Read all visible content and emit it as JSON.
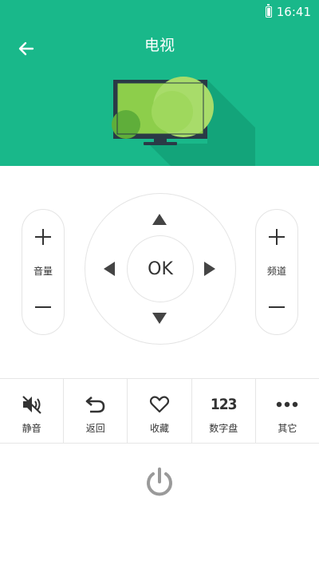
{
  "status": {
    "time": "16:41"
  },
  "header": {
    "title": "电视",
    "bg_color": "#19b88a"
  },
  "volume": {
    "label": "音量",
    "plus_icon": "plus-icon",
    "minus_icon": "minus-icon"
  },
  "channel": {
    "label": "频道",
    "plus_icon": "plus-icon",
    "minus_icon": "minus-icon"
  },
  "dpad": {
    "ok_label": "OK"
  },
  "functions": [
    {
      "label": "静音",
      "icon": "mute-icon"
    },
    {
      "label": "返回",
      "icon": "return-icon"
    },
    {
      "label": "收藏",
      "icon": "heart-icon"
    },
    {
      "label": "数字盘",
      "icon": "number-pad-icon",
      "icon_text": "123"
    },
    {
      "label": "其它",
      "icon": "more-icon"
    }
  ],
  "power": {
    "icon": "power-icon"
  }
}
